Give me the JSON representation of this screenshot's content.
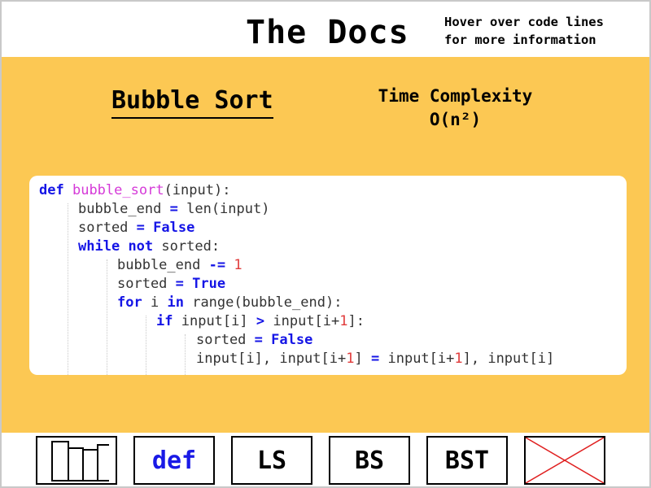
{
  "header": {
    "title": "The Docs",
    "hint_line1": "Hover over code lines",
    "hint_line2": "for more information"
  },
  "algorithm": {
    "name": "Bubble Sort",
    "complexity_label": "Time Complexity",
    "complexity_value": "O(n²)"
  },
  "code": {
    "l1": {
      "kw": "def",
      "fn": "bubble_sort",
      "rest": "(input):"
    },
    "l2": {
      "a": "bubble_end",
      "op": "=",
      "b": "len(input)"
    },
    "l3": {
      "a": "sorted",
      "op": "=",
      "val": "False"
    },
    "l4": {
      "kw1": "while",
      "kw2": "not",
      "rest": "sorted:"
    },
    "l5": {
      "a": "bubble_end",
      "op": "-=",
      "num": "1"
    },
    "l6": {
      "a": "sorted",
      "op": "=",
      "val": "True"
    },
    "l7": {
      "kw1": "for",
      "a": "i",
      "kw2": "in",
      "rest": "range(bubble_end):"
    },
    "l8": {
      "kw": "if",
      "a": "input[i]",
      "op": ">",
      "b": "input[i+",
      "num": "1",
      "c": "]:"
    },
    "l9": {
      "a": "sorted",
      "op": "=",
      "val": "False"
    },
    "l10": {
      "a": "input[i], input[i+",
      "num1": "1",
      "b": "]",
      "op": "=",
      "c": "input[i+",
      "num2": "1",
      "d": "], input[i]"
    }
  },
  "nav": {
    "home_icon": "bar-chart-icon",
    "def_label": "def",
    "ls_label": "LS",
    "bs_label": "BS",
    "bst_label": "BST",
    "close_icon": "red-x-icon"
  },
  "colors": {
    "accent_yellow": "#fcc853",
    "keyword_blue": "#1515e6",
    "function_magenta": "#d53ad8",
    "number_red": "#e03b3b",
    "close_red": "#e02020"
  }
}
